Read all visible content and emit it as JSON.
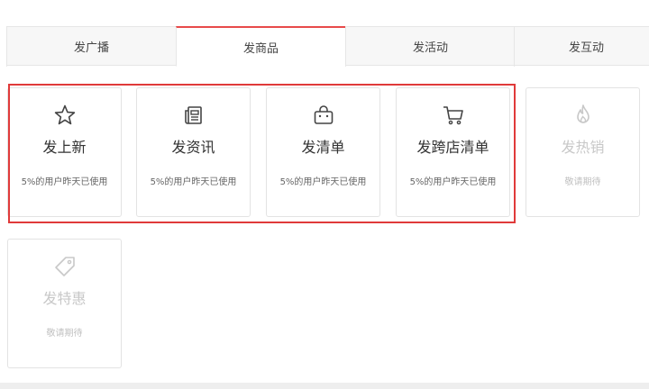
{
  "tabs": [
    {
      "label": "发广播",
      "active": false
    },
    {
      "label": "发商品",
      "active": true
    },
    {
      "label": "发活动",
      "active": false
    },
    {
      "label": "发互动",
      "active": false
    }
  ],
  "cards": [
    {
      "icon": "star-icon",
      "title": "发上新",
      "subtitle": "5%的用户昨天已使用",
      "enabled": true
    },
    {
      "icon": "newspaper-icon",
      "title": "发资讯",
      "subtitle": "5%的用户昨天已使用",
      "enabled": true
    },
    {
      "icon": "shopping-bag-icon",
      "title": "发清单",
      "subtitle": "5%的用户昨天已使用",
      "enabled": true
    },
    {
      "icon": "shopping-cart-icon",
      "title": "发跨店清单",
      "subtitle": "5%的用户昨天已使用",
      "enabled": true
    },
    {
      "icon": "fire-icon",
      "title": "发热销",
      "subtitle": "敬请期待",
      "enabled": false
    },
    {
      "icon": "tag-icon",
      "title": "发特惠",
      "subtitle": "敬请期待",
      "enabled": false
    }
  ],
  "colors": {
    "accent": "#e84a4a",
    "highlight": "#e03a3a",
    "disabled": "#c8c8c8"
  }
}
